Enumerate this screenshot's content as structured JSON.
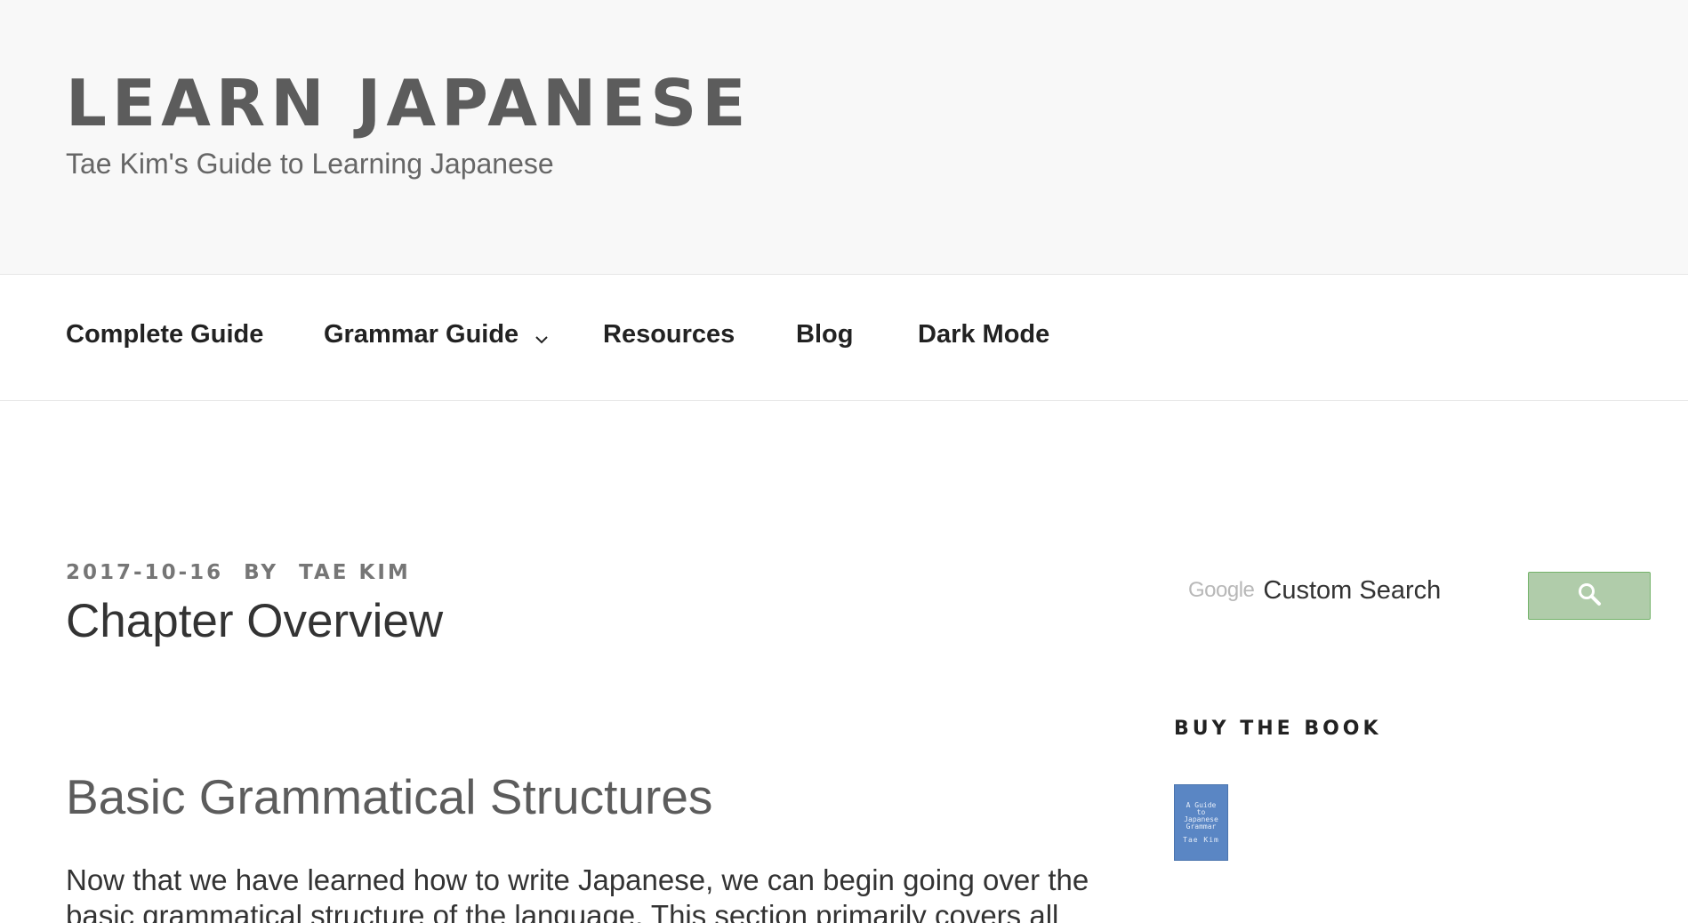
{
  "header": {
    "site_title": "LEARN JAPANESE",
    "site_description": "Tae Kim's Guide to Learning Japanese"
  },
  "nav": {
    "items": [
      {
        "label": "Complete Guide"
      },
      {
        "label": "Grammar Guide",
        "has_dropdown": true
      },
      {
        "label": "Resources"
      },
      {
        "label": "Blog"
      },
      {
        "label": "Dark Mode"
      }
    ]
  },
  "post": {
    "date": "2017-10-16",
    "by": "BY",
    "author": "TAE KIM",
    "title": "Chapter Overview",
    "section_heading": "Basic Grammatical Structures",
    "body": "Now that we have learned how to write Japanese, we can begin going over the basic grammatical structure of the language. This section primarily covers all"
  },
  "sidebar": {
    "search": {
      "google_logo": "Google",
      "placeholder": "Custom Search",
      "button_icon": "search-icon"
    },
    "buy_book": {
      "title": "BUY THE BOOK",
      "cover_lines": [
        "A Guide",
        "to",
        "Japanese",
        "Grammar"
      ],
      "cover_author": "Tae Kim"
    }
  },
  "colors": {
    "header_bg": "#f8f8f8",
    "search_button": "#b0ccaa",
    "book_cover": "#5a86c4"
  }
}
